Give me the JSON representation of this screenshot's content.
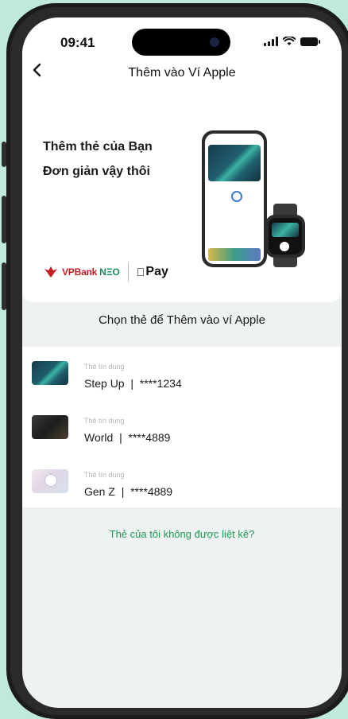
{
  "status_bar": {
    "time": "09:41"
  },
  "nav": {
    "back_icon": "chevron-left-icon",
    "title": "Thêm vào Ví Apple"
  },
  "promo": {
    "line1": "Thêm thẻ của Bạn",
    "line2": "Đơn giản vậy thôi",
    "brand": {
      "vpbank": "VPBank",
      "neo": "NΞO",
      "apple_pay": "Pay",
      "vpbank_color": "#c41e24",
      "neo_color": "#1b8a5a"
    }
  },
  "section_title": "Chọn thẻ để Thêm vào ví Apple",
  "cards": [
    {
      "type": "Thẻ tín dụng",
      "name": "Step Up",
      "number": "****1234",
      "icon": "stepup-card-thumbnail"
    },
    {
      "type": "Thẻ tín dụng",
      "name": "World",
      "number": "****4889",
      "icon": "world-card-thumbnail"
    },
    {
      "type": "Thẻ tín dụng",
      "name": "Gen Z",
      "number": "****4889",
      "icon": "genz-card-thumbnail"
    }
  ],
  "card_separator": "|",
  "not_listed_link": "Thẻ của tôi không được liệt kê?",
  "colors": {
    "accent_green": "#1d9a58",
    "background": "#bfe9dc"
  }
}
